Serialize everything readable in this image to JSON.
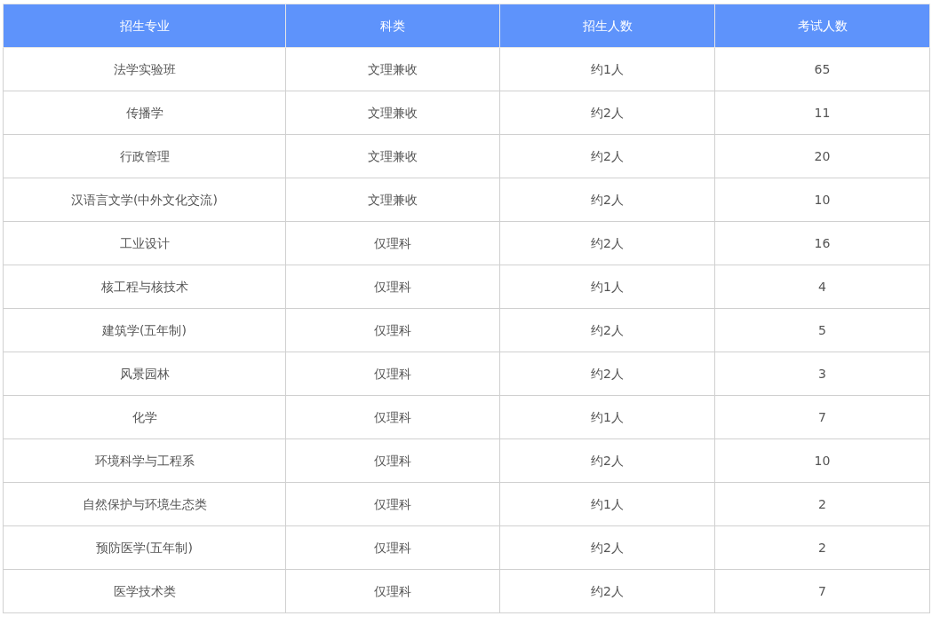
{
  "table": {
    "columns": [
      "招生专业",
      "科类",
      "招生人数",
      "考试人数"
    ],
    "rows": [
      [
        "法学实验班",
        "文理兼收",
        "约1人",
        "65"
      ],
      [
        "传播学",
        "文理兼收",
        "约2人",
        "11"
      ],
      [
        "行政管理",
        "文理兼收",
        "约2人",
        "20"
      ],
      [
        "汉语言文学(中外文化交流)",
        "文理兼收",
        "约2人",
        "10"
      ],
      [
        "工业设计",
        "仅理科",
        "约2人",
        "16"
      ],
      [
        "核工程与核技术",
        "仅理科",
        "约1人",
        "4"
      ],
      [
        "建筑学(五年制)",
        "仅理科",
        "约2人",
        "5"
      ],
      [
        "风景园林",
        "仅理科",
        "约2人",
        "3"
      ],
      [
        "化学",
        "仅理科",
        "约1人",
        "7"
      ],
      [
        "环境科学与工程系",
        "仅理科",
        "约2人",
        "10"
      ],
      [
        "自然保护与环境生态类",
        "仅理科",
        "约1人",
        "2"
      ],
      [
        "预防医学(五年制)",
        "仅理科",
        "约2人",
        "2"
      ],
      [
        "医学技术类",
        "仅理科",
        "约2人",
        "7"
      ]
    ]
  }
}
